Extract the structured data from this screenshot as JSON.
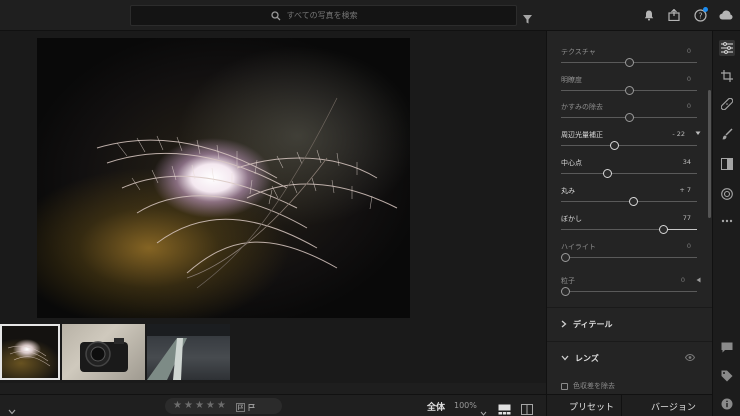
{
  "search": {
    "placeholder": "すべての写真を検索"
  },
  "panel": {
    "sliders_top": [
      {
        "label": "テクスチャ",
        "value": "0",
        "pos": 0.5
      },
      {
        "label": "明瞭度",
        "value": "0",
        "pos": 0.5
      },
      {
        "label": "かすみの除去",
        "value": "0",
        "pos": 0.5
      }
    ],
    "vignette": {
      "label": "周辺光量補正",
      "value": "- 22",
      "pos": 0.39,
      "sub": [
        {
          "label": "中心点",
          "value": "34",
          "pos": 0.34
        },
        {
          "label": "丸み",
          "value": "+ 7",
          "pos": 0.53
        },
        {
          "label": "ぼかし",
          "value": "77",
          "pos": 0.77
        },
        {
          "label": "ハイライト",
          "value": "0",
          "pos": 0.0
        }
      ]
    },
    "grain": {
      "label": "粒子",
      "value": "0",
      "pos": 0.0
    },
    "sections": {
      "detail": "ディテール",
      "lens": "レンズ"
    },
    "lens_checkbox": "色収差を除去"
  },
  "bottombar": {
    "stars": [
      "★",
      "★",
      "★",
      "★",
      "★"
    ],
    "fit": "全体",
    "zoom": "100%"
  },
  "preset_bar": {
    "presets": "プリセット",
    "versions": "バージョン"
  },
  "colors": {
    "accent": "#1c8cf0",
    "panel": "#242424",
    "bg": "#1e1e1e"
  }
}
